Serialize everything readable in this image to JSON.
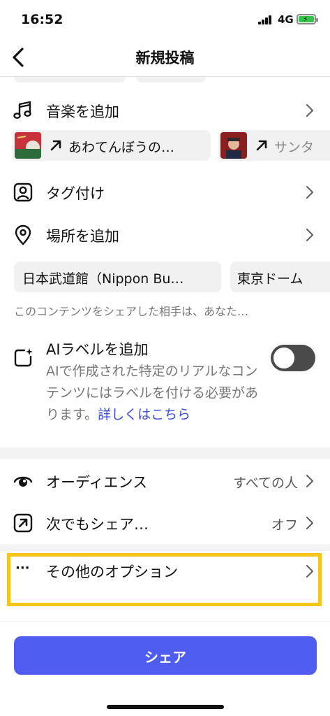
{
  "status_bar": {
    "time": "16:52",
    "network": "4G"
  },
  "nav": {
    "title": "新規投稿",
    "back_icon": "chevron-left-icon"
  },
  "music": {
    "label": "音楽を追加",
    "icon": "music-note-icon",
    "suggestions": [
      {
        "title": "あわてんぼうの…"
      },
      {
        "title": "サンタ"
      }
    ]
  },
  "tag": {
    "label": "タグ付け",
    "icon": "person-tag-icon"
  },
  "location": {
    "label": "場所を追加",
    "icon": "location-pin-icon",
    "suggestions": [
      "日本武道館（Nippon Bu…",
      "東京ドーム"
    ],
    "hint": "このコンテンツをシェアした相手は、あなた…"
  },
  "ai_label": {
    "title": "AIラベルを追加",
    "description": "AIで作成された特定のリアルなコンテンツにはラベルを付ける必要があります。",
    "link": "詳しくはこちら",
    "enabled": false
  },
  "audience": {
    "label": "オーディエンス",
    "value": "すべての人",
    "icon": "eye-icon"
  },
  "share_to": {
    "label": "次でもシェア…",
    "value": "オフ",
    "icon": "share-arrow-icon"
  },
  "more_options": {
    "label": "その他のオプション",
    "icon": "more-dots-icon",
    "dots": "···"
  },
  "share_button": {
    "label": "シェア"
  },
  "colors": {
    "accent": "#4f5cf0",
    "link": "#3b4cd8",
    "highlight": "#f5c518",
    "battery": "#33c44a"
  }
}
